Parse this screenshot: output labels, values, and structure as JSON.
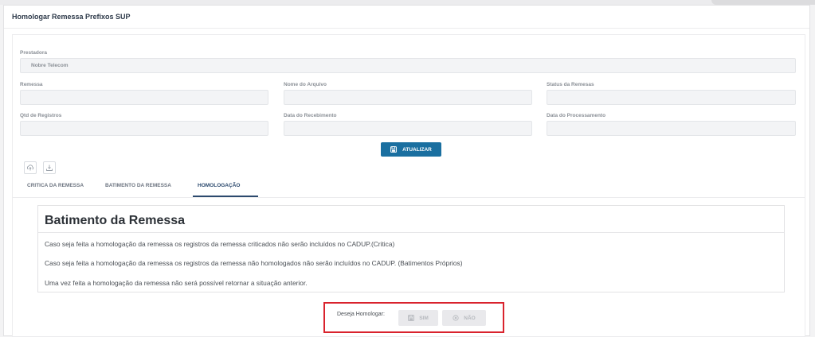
{
  "page": {
    "title": "Homologar Remessa Prefixos SUP"
  },
  "form": {
    "prestadora_label": "Prestadora",
    "prestadora_value": "Nobre Telecom",
    "remessa_label": "Remessa",
    "remessa_value": "",
    "nome_arquivo_label": "Nome do Arquivo",
    "nome_arquivo_value": "",
    "status_label": "Status da Remesas",
    "status_value": "",
    "qtd_label": "Qtd de Registros",
    "qtd_value": "",
    "data_recebimento_label": "Data do Recebimento",
    "data_recebimento_value": "",
    "data_processamento_label": "Data do Processamento",
    "data_processamento_value": ""
  },
  "actions": {
    "atualizar_label": "ATUALIZAR"
  },
  "tabs": [
    {
      "label": "CRITICA DA REMESSA",
      "active": false
    },
    {
      "label": "BATIMENTO DA REMESSA",
      "active": false
    },
    {
      "label": "HOMOLOGAÇÃO",
      "active": true
    }
  ],
  "panel": {
    "title": "Batimento da Remessa",
    "messages": [
      "Caso seja feita a homologação da remessa os registros da remessa criticados não serão incluídos no CADUP.(Critica)",
      "Caso seja feita a homologação da remessa os registros da remessa não homologados não serão incluídos no CADUP. (Batimentos Próprios)",
      "Uma vez feita a homologação da remessa não será possível retornar a situação anterior."
    ]
  },
  "homologar": {
    "label": "Deseja Homologar:",
    "sim_label": "SIM",
    "nao_label": "NÃO",
    "highlight_color": "#d9232d"
  },
  "colors": {
    "primary": "#1a6fa0",
    "tab_active": "#2c4a6e"
  },
  "icons": {
    "upload": "upload-icon",
    "download": "download-icon",
    "save": "floppy-disk-icon",
    "cancel": "cancel-circle-icon"
  }
}
